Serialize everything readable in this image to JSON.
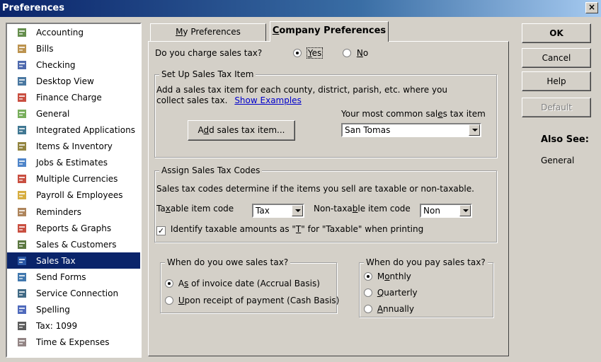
{
  "window": {
    "title": "Preferences",
    "close": "×"
  },
  "sidebar": {
    "items": [
      {
        "label": "Accounting",
        "icon": "accounting-icon"
      },
      {
        "label": "Bills",
        "icon": "bills-icon"
      },
      {
        "label": "Checking",
        "icon": "checking-icon"
      },
      {
        "label": "Desktop View",
        "icon": "desktop-view-icon"
      },
      {
        "label": "Finance Charge",
        "icon": "finance-charge-icon"
      },
      {
        "label": "General",
        "icon": "general-icon"
      },
      {
        "label": "Integrated Applications",
        "icon": "integrated-apps-icon"
      },
      {
        "label": "Items & Inventory",
        "icon": "items-inventory-icon"
      },
      {
        "label": "Jobs & Estimates",
        "icon": "jobs-estimates-icon"
      },
      {
        "label": "Multiple Currencies",
        "icon": "currencies-icon"
      },
      {
        "label": "Payroll & Employees",
        "icon": "payroll-icon"
      },
      {
        "label": "Reminders",
        "icon": "reminders-icon"
      },
      {
        "label": "Reports & Graphs",
        "icon": "reports-graphs-icon"
      },
      {
        "label": "Sales & Customers",
        "icon": "sales-customers-icon"
      },
      {
        "label": "Sales Tax",
        "icon": "sales-tax-icon",
        "selected": true
      },
      {
        "label": "Send Forms",
        "icon": "send-forms-icon"
      },
      {
        "label": "Service Connection",
        "icon": "service-connection-icon"
      },
      {
        "label": "Spelling",
        "icon": "spelling-icon"
      },
      {
        "label": "Tax: 1099",
        "icon": "tax-1099-icon"
      },
      {
        "label": "Time & Expenses",
        "icon": "time-expenses-icon"
      }
    ]
  },
  "tabs": {
    "my_prefs": {
      "pre": "",
      "key": "M",
      "rest": "y Preferences"
    },
    "company_prefs": {
      "pre": "",
      "key": "C",
      "rest": "ompany Preferences"
    }
  },
  "charge": {
    "question": "Do you charge sales tax?",
    "yes": {
      "key": "Y",
      "rest": "es",
      "selected": true
    },
    "no": {
      "key": "N",
      "rest": "o",
      "selected": false
    }
  },
  "setup": {
    "legend": "Set Up Sales Tax Item",
    "desc1": "Add a sales tax item for each county, district, parish, etc. where you",
    "desc2": "collect sales tax.",
    "examples_link": "Show Examples",
    "add_btn": {
      "pre": "A",
      "key": "d",
      "rest": "d sales tax item..."
    },
    "common_label": {
      "pre": "Your most common sal",
      "key": "e",
      "rest": "s tax item"
    },
    "common_value": "San Tomas"
  },
  "codes": {
    "legend": "Assign Sales Tax Codes",
    "desc": "Sales tax codes determine if the items you sell are taxable or non-taxable.",
    "taxable_label": {
      "pre": "Ta",
      "key": "x",
      "rest": "able item code"
    },
    "taxable_value": "Tax",
    "nontaxable_label": {
      "pre": "Non-taxa",
      "key": "b",
      "rest": "le item code"
    },
    "nontaxable_value": "Non",
    "identify": {
      "pre": "Identify taxable amounts as \"",
      "key": "T",
      "rest": "\" for \"Taxable\" when printing",
      "checked": true
    }
  },
  "owe": {
    "legend": "When do you owe sales tax?",
    "accrual": {
      "pre": "A",
      "key": "s",
      "rest": " of invoice date (Accrual Basis)",
      "selected": true
    },
    "cash": {
      "pre": "",
      "key": "U",
      "rest": "pon receipt of payment (Cash Basis)",
      "selected": false
    }
  },
  "pay": {
    "legend": "When do you pay sales tax?",
    "monthly": {
      "pre": "M",
      "key": "o",
      "rest": "nthly",
      "selected": true
    },
    "quarterly": {
      "pre": "",
      "key": "Q",
      "rest": "uarterly",
      "selected": false
    },
    "annually": {
      "pre": "",
      "key": "A",
      "rest": "nnually",
      "selected": false
    }
  },
  "buttons": {
    "ok": "OK",
    "cancel": "Cancel",
    "help": "Help",
    "default": "Default"
  },
  "also_see": {
    "title": "Also See:",
    "general": "General"
  }
}
